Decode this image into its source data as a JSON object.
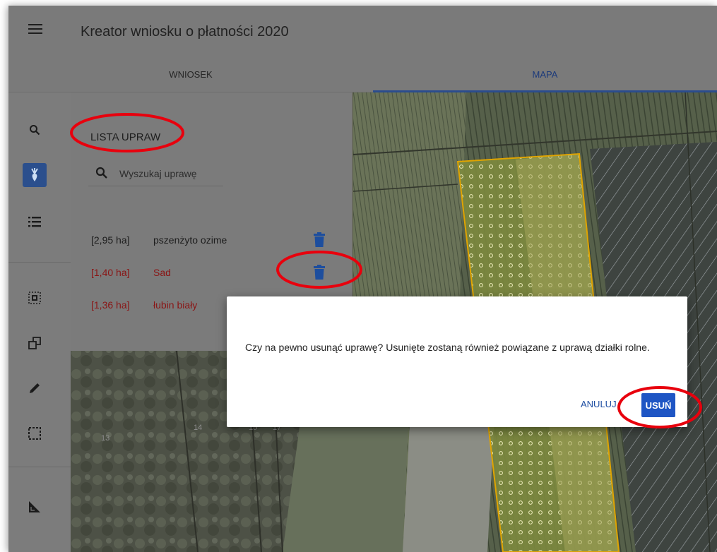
{
  "header": {
    "title": "Kreator wniosku o płatności 2020",
    "menu_icon": "hamburger-menu-icon"
  },
  "tabs": [
    {
      "label": "WNIOSEK",
      "active": false
    },
    {
      "label": "MAPA",
      "active": true
    }
  ],
  "sidebar": {
    "tools": [
      "search-icon",
      "crop-beet-icon",
      "list-icon",
      "select-parcels-icon",
      "copy-icon",
      "pencil-icon",
      "select-area-icon",
      "measure-angle-icon"
    ],
    "active_tool": "crop-beet-icon"
  },
  "panel": {
    "title": "LISTA UPRAW",
    "search": {
      "placeholder": "Wyszukaj uprawę",
      "value": ""
    },
    "crops": [
      {
        "area": "[2,95 ha]",
        "name": "pszenżyto ozime",
        "color": "#1c1c1c"
      },
      {
        "area": "[1,40 ha]",
        "name": "Sad",
        "color": "#8a1515"
      },
      {
        "area": "[1,36 ha]",
        "name": "łubin biały",
        "color": "#8a1515"
      }
    ]
  },
  "map": {
    "parcel_labels": [
      "13",
      "14",
      "15",
      "17"
    ]
  },
  "dialog": {
    "message": "Czy na pewno usunąć uprawę? Usunięte zostaną również powiązane z uprawą działki rolne.",
    "cancel_label": "ANULUJ",
    "confirm_label": "USUŃ"
  },
  "colors": {
    "accent": "#1e55c4",
    "annotation": "#e8000d",
    "overlay_gray": "#7a7a7a"
  }
}
